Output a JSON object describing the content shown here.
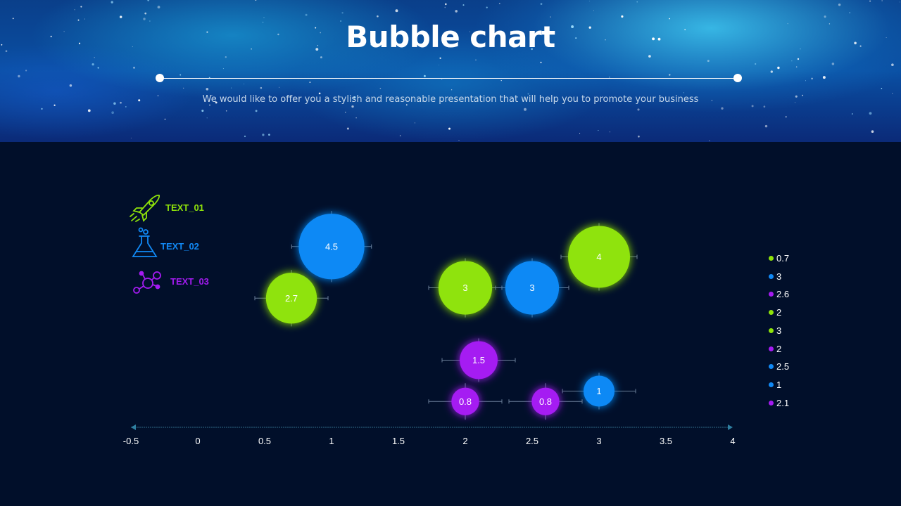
{
  "header": {
    "title": "Bubble chart",
    "subtitle": "We would like to offer you a stylish and reasonable presentation that will help you to promote your business"
  },
  "legend": [
    {
      "label": "TEXT_01",
      "color": "#8fe30a",
      "icon": "rocket-icon"
    },
    {
      "label": "TEXT_02",
      "color": "#1189f5",
      "icon": "flask-icon"
    },
    {
      "label": "TEXT_03",
      "color": "#a51bf2",
      "icon": "molecule-icon"
    }
  ],
  "chart_data": {
    "type": "scatter",
    "subtype": "bubble",
    "xlim": [
      -0.5,
      4
    ],
    "x_ticks": [
      "-0.5",
      "0",
      "0.5",
      "1",
      "1.5",
      "2",
      "2.5",
      "3",
      "3.5",
      "4"
    ],
    "grid": false,
    "error_bars": true,
    "series": [
      {
        "name": "TEXT_01",
        "color": "#8fe30a",
        "points": [
          {
            "x": 0.7,
            "y": 2.0,
            "size": 2.7,
            "label": "2.7"
          },
          {
            "x": 2.0,
            "y": 2.1,
            "size": 3.0,
            "label": "3"
          },
          {
            "x": 3.0,
            "y": 2.4,
            "size": 4.0,
            "label": "4"
          }
        ]
      },
      {
        "name": "TEXT_02",
        "color": "#1189f5",
        "points": [
          {
            "x": 1.0,
            "y": 2.5,
            "size": 4.5,
            "label": "4.5"
          },
          {
            "x": 2.5,
            "y": 2.1,
            "size": 3.0,
            "label": "3"
          },
          {
            "x": 3.0,
            "y": 1.1,
            "size": 1.0,
            "label": "1"
          }
        ]
      },
      {
        "name": "TEXT_03",
        "color": "#a51bf2",
        "points": [
          {
            "x": 2.1,
            "y": 1.4,
            "size": 1.5,
            "label": "1.5"
          },
          {
            "x": 2.0,
            "y": 1.0,
            "size": 0.8,
            "label": "0.8"
          },
          {
            "x": 2.6,
            "y": 1.0,
            "size": 0.8,
            "label": "0.8"
          }
        ]
      }
    ],
    "side_legend": [
      {
        "label": "0.7",
        "color": "#8fe30a"
      },
      {
        "label": "3",
        "color": "#1189f5"
      },
      {
        "label": "2.6",
        "color": "#a51bf2"
      },
      {
        "label": "2",
        "color": "#8fe30a"
      },
      {
        "label": "3",
        "color": "#8fe30a"
      },
      {
        "label": "2",
        "color": "#a51bf2"
      },
      {
        "label": "2.5",
        "color": "#1189f5"
      },
      {
        "label": "1",
        "color": "#1189f5"
      },
      {
        "label": "2.1",
        "color": "#a51bf2"
      }
    ]
  }
}
